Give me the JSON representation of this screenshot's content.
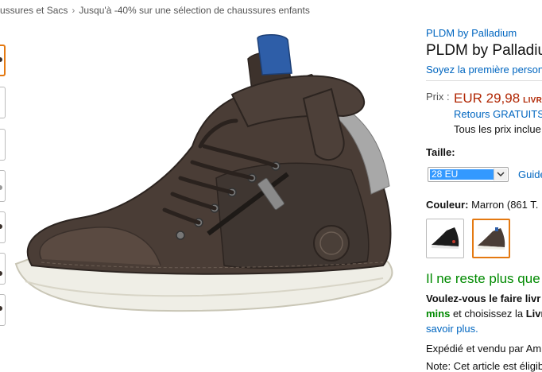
{
  "breadcrumb": {
    "items": [
      "ussures et Sacs",
      "Jusqu'à -40% sur une sélection de chaussures enfants"
    ],
    "separator": "›"
  },
  "product": {
    "brand_link": "PLDM by Palladium",
    "title": "PLDM by Palladiu",
    "review_link": "Soyez la première person",
    "price_label": "Prix :",
    "price": "EUR 29,98",
    "shipping_badge": "LIVR",
    "returns": "Retours GRATUITS",
    "taxes": "Tous les prix inclue",
    "size_label": "Taille:",
    "size_value": "28 EU",
    "size_guide": "Guide",
    "color_label": "Couleur:",
    "color_value": "Marron (861 T.",
    "stock": "Il ne reste plus que",
    "delivery_line1": "Voulez-vous le faire livr",
    "delivery_line2_green": "mins",
    "delivery_line2_mid": " et choisissez la ",
    "delivery_line2_bold": "Livr",
    "learn_more": "savoir plus.",
    "sold_by": "Expédié et vendu par Am",
    "cut_line": "Note: Cet article est éligibl"
  },
  "colors": {
    "accent": "#e47911",
    "link": "#0066c0",
    "price": "#b12704",
    "stock": "#008a00",
    "select_highlight": "#3399ff"
  },
  "icons": {
    "breadcrumb_separator": "chevron-right-icon",
    "dropdown": "chevron-down-icon"
  }
}
